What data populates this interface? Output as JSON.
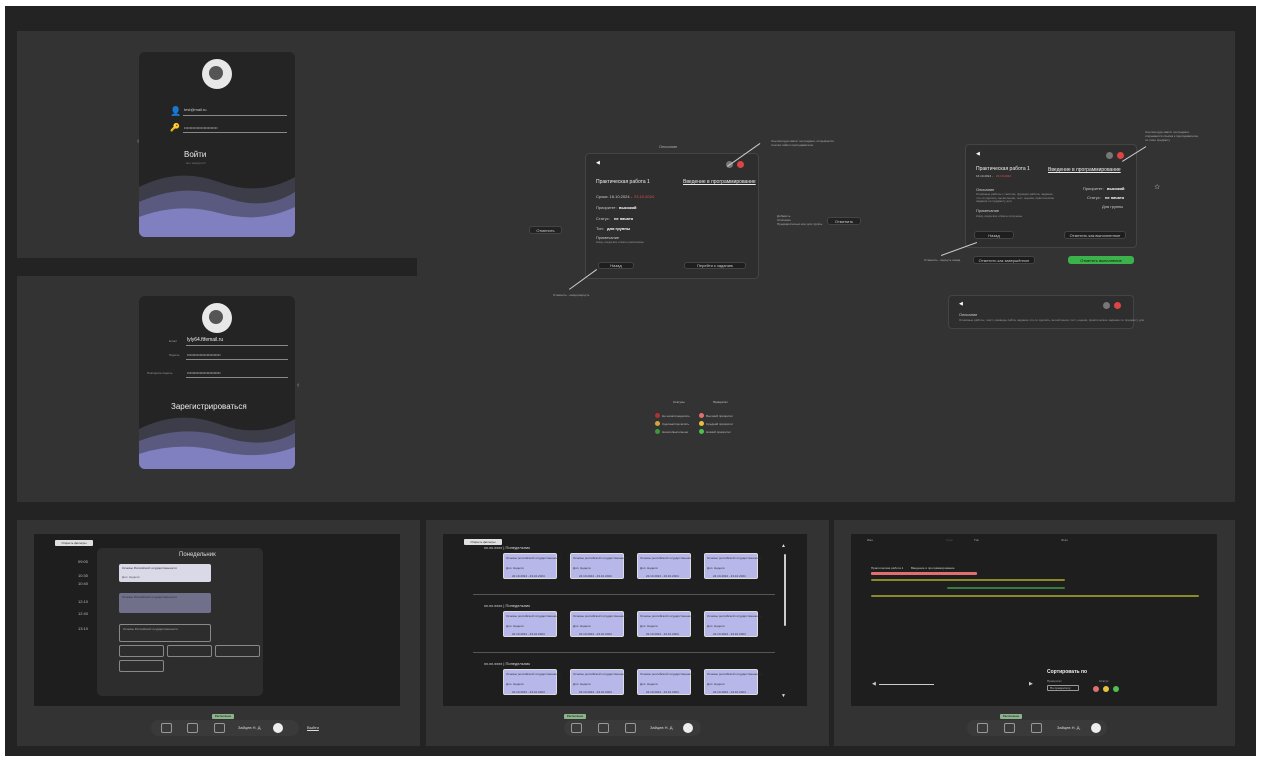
{
  "login": {
    "email_value": "test@mail.ru",
    "password_dots": "••••••••••••••••••••••••",
    "submit_label": "Войти",
    "submit_hint": "Нет аккаунта?"
  },
  "register": {
    "email_label": "Email",
    "email_value": "lyly64.ftfemail.ru",
    "password_label": "Пароль",
    "password_dots": "••••••••••••••••••••••••",
    "repeat_label": "Повторите пароль",
    "repeat_dots": "••••••••••••••••••••••••",
    "submit_label": "Зарегистрироваться"
  },
  "task_modal_a": {
    "caption": "Описание",
    "title": "Практическая работа 1",
    "course_link": "Введение в программирование",
    "deadline_label": "Сроки: 16.10.2024 -",
    "deadline_end": "23.10.2024",
    "priority_label": "Приоритет:",
    "priority_value": "высокий",
    "status_label": "Статус:",
    "status_value": "не начато",
    "type_label": "Тип:",
    "type_value": "для группы",
    "note_label": "Примечание",
    "note_text": "Кому, когда все ответы расписаны",
    "back_button": "Назад",
    "done_button": "Перейти к заданию",
    "note_left_button": "Отменить",
    "note_bottom": "Отменить - назад вернуть",
    "note_top": "Ссылка куда хватит на предмет, открывается ссылка тайм к преподавателю",
    "note_right_text": "Добавить\nОписание\nПредварительно все для группы",
    "note_right_button": "Отменить"
  },
  "task_modal_b": {
    "title": "Практическая работа 1",
    "course_link": "Введение в программирование",
    "dates": "16.10.2024 -",
    "dates_end": "23.10.2024",
    "description_label": "Описание",
    "description_text": "Основные работы с текстом, функция работа, задание что-то сделать, вычисления, тест, оценка, практическое задание по предмету для",
    "priority_label": "Приоритет:",
    "priority_value": "высокий",
    "status_label": "Статус:",
    "status_value": "не начато",
    "type_value": "Для группы",
    "note_label": "Примечание",
    "note_text": "Кому, когда все ответы получены",
    "back_button": "Назад",
    "complete_button": "Отметить как выполненное",
    "complete_button_outline": "Отметить как завершённое",
    "complete_button_green": "Отметить выполнение",
    "note_top": "Ссылка куда хватит на предмет, открывается ссылка к преподавателю, по теме предмету",
    "note_left": "Отменить - вернуть назад"
  },
  "task_mini": {
    "description_label": "Описание",
    "description_text": "Основные работы, текст, команды сайта, задание что-то сделать, вычисления, тест, оценка, практическое задание по предмету для"
  },
  "legend": {
    "status_title": "Статусы",
    "priority_title": "Приоритет",
    "status_items": [
      "Не начато/неделать",
      "Сделано/прочитать",
      "Начато/выполнено"
    ],
    "priority_items": [
      "Высокий приоритет",
      "Средний приоритет",
      "Низкий приоритет"
    ],
    "status_colors": [
      "#aa3333",
      "#d6a23a",
      "#3a9a3a"
    ],
    "priority_colors": [
      "#e07070",
      "#e6c23c",
      "#4fc04f"
    ]
  },
  "schedule_day": {
    "top_button": "Открыть фильтры",
    "day_title": "Понедельник",
    "times": [
      "09:00",
      "10:30",
      "10:40",
      "12:10",
      "12:40",
      "13:10"
    ],
    "slot_title": "Основы Российской государственности",
    "slot_sub": "Доп. Неделя"
  },
  "schedule_week": {
    "top_button": "Открыть фильтры",
    "day_headers": [
      "хх.хх.хххх | Понедельник",
      "хх.хх.хххх | Понедельник",
      "хх.хх.хххх | Понедельник"
    ],
    "lesson_title": "Основы российской государственности",
    "lesson_type": "Доп. Неделя",
    "lesson_dates": "22.10.2024 - 23.10.2024"
  },
  "gantt": {
    "headers": [
      "Имя",
      "Срок",
      "Тип",
      "Этап"
    ],
    "task_label": "Практическая работа 1",
    "course_label": "Введение в программирование",
    "sort_title": "Сортировать по",
    "sort_priority_label": "Приоритет",
    "sort_status_label": "Статус",
    "sort_select": "По приоритету"
  },
  "navbar": {
    "user_name": "Зайцев Н. Д.",
    "tooltip": "Расписание",
    "logout": "Выйти"
  }
}
